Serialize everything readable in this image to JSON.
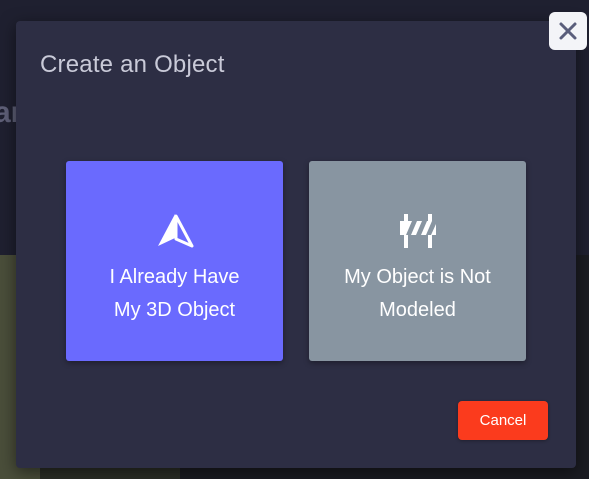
{
  "background": {
    "partial_heading": "ar"
  },
  "modal": {
    "title": "Create an Object",
    "close_icon": "close-icon",
    "options": [
      {
        "label": "I Already Have\nMy 3D Object",
        "icon": "prism-3d-icon",
        "color": "#6a6afe"
      },
      {
        "label": "My Object is Not\nModeled",
        "icon": "road-barrier-icon",
        "color": "#8895a1"
      }
    ],
    "cancel_label": "Cancel",
    "cancel_color": "#fb3b1d"
  }
}
